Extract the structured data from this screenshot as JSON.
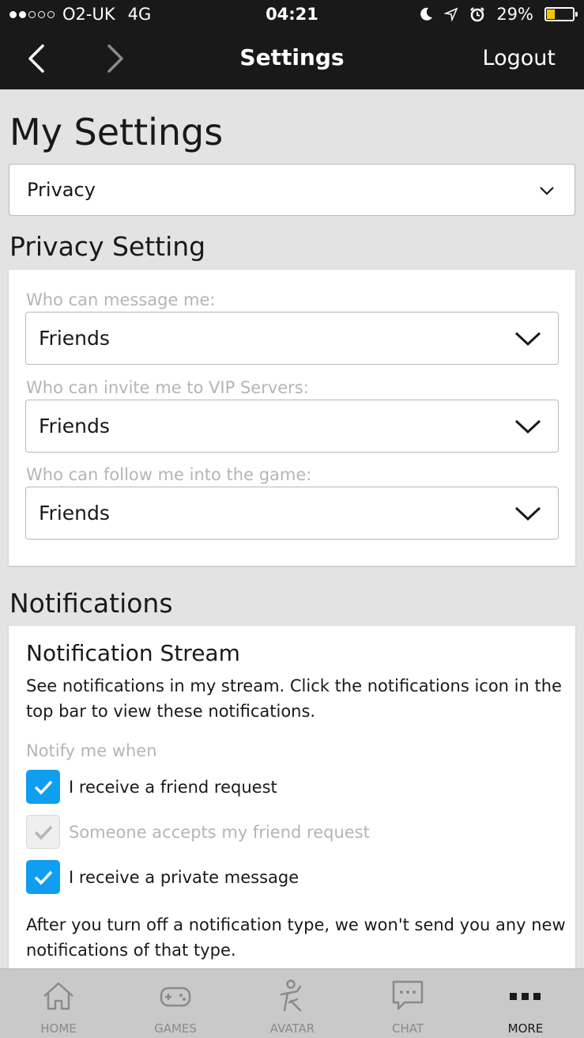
{
  "status_bar": {
    "carrier": "O2-UK",
    "network": "4G",
    "time": "04:21",
    "battery": "29%",
    "battery_level": 0.29,
    "icons": [
      "moon-icon",
      "location-icon",
      "alarm-icon",
      "battery-icon"
    ]
  },
  "nav": {
    "title": "Settings",
    "logout_label": "Logout"
  },
  "page": {
    "title": "My Settings",
    "category_select": "Privacy"
  },
  "privacy": {
    "heading": "Privacy Setting",
    "fields": [
      {
        "label": "Who can message me:",
        "value": "Friends"
      },
      {
        "label": "Who can invite me to VIP Servers:",
        "value": "Friends"
      },
      {
        "label": "Who can follow me into the game:",
        "value": "Friends"
      }
    ]
  },
  "notifications": {
    "heading": "Notifications",
    "stream_title": "Notification Stream",
    "stream_desc": "See notifications in my stream. Click the notifications icon in the top bar to view these notifications.",
    "notify_label": "Notify me when",
    "options": [
      {
        "label": "I receive a friend request",
        "checked": true,
        "disabled": false
      },
      {
        "label": "Someone accepts my friend request",
        "checked": true,
        "disabled": true
      },
      {
        "label": "I receive a private message",
        "checked": true,
        "disabled": false
      }
    ],
    "footer": "After you turn off a notification type, we won't send you any new notifications of that type."
  },
  "tabs": [
    {
      "label": "HOME",
      "icon": "home-icon"
    },
    {
      "label": "GAMES",
      "icon": "gamepad-icon"
    },
    {
      "label": "AVATAR",
      "icon": "avatar-icon"
    },
    {
      "label": "CHAT",
      "icon": "chat-icon"
    },
    {
      "label": "MORE",
      "icon": "more-icon",
      "active": true
    }
  ],
  "colors": {
    "bar_dark": "#191919",
    "accent_blue": "#0f9ef0",
    "background": "#e3e3e3",
    "battery_yellow": "#f5c700"
  }
}
